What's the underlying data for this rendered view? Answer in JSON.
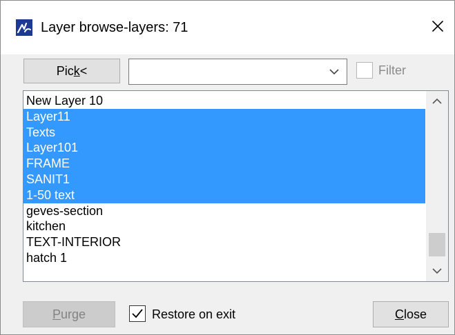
{
  "window": {
    "title": "Layer browse-layers: 71"
  },
  "toolbar": {
    "pick_label_pre": "Pic",
    "pick_label_accel": "k",
    "pick_label_post": "<",
    "combo_value": "",
    "filter_label": "Filter",
    "filter_checked": false
  },
  "list": {
    "items": [
      {
        "label": "New Layer 10",
        "selected": false
      },
      {
        "label": "Layer11",
        "selected": true
      },
      {
        "label": "Texts",
        "selected": true
      },
      {
        "label": "Layer101",
        "selected": true
      },
      {
        "label": "FRAME",
        "selected": true
      },
      {
        "label": "SANIT1",
        "selected": true
      },
      {
        "label": "1-50 text",
        "selected": true
      },
      {
        "label": "geves-section",
        "selected": false
      },
      {
        "label": "kitchen",
        "selected": false
      },
      {
        "label": "TEXT-INTERIOR",
        "selected": false
      },
      {
        "label": "hatch 1",
        "selected": false
      }
    ]
  },
  "footer": {
    "purge_accel": "P",
    "purge_rest": "urge",
    "restore_label": "Restore on exit",
    "restore_checked": true,
    "close_accel": "C",
    "close_rest": "lose"
  },
  "colors": {
    "selection": "#3399ff",
    "app_icon": "#1c3a94"
  },
  "icons": {
    "app": "app-logo-icon",
    "close": "close-icon",
    "dropdown": "chevron-down-icon",
    "scroll_up": "chevron-up-icon",
    "scroll_down": "chevron-down-icon",
    "check": "checkmark-icon"
  }
}
